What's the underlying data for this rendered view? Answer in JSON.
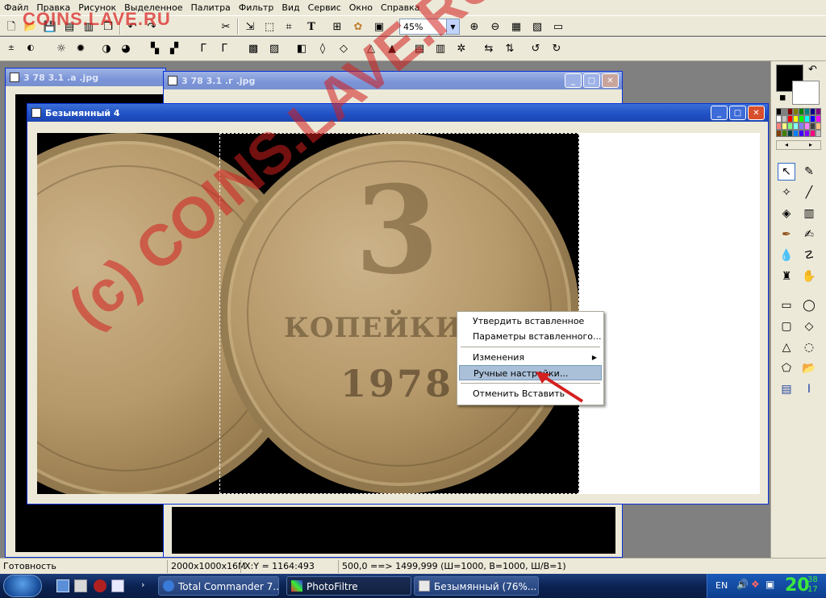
{
  "menu": [
    "Файл",
    "Правка",
    "Рисунок",
    "Выделенное",
    "Палитра",
    "Фильтр",
    "Вид",
    "Сервис",
    "Окно",
    "Справка"
  ],
  "toolbar": {
    "zoom_value": "45%"
  },
  "windows": {
    "back1_title": "3 78 3.1 .а .jpg",
    "back2_title": "3 78 3.1 .г .jpg",
    "main_title": "Безымянный 4"
  },
  "context_menu": {
    "items": [
      "Утвердить вставленное",
      "Параметры вставленного...",
      "Изменения",
      "Ручные настройки...",
      "Отменить Вставить"
    ]
  },
  "status": {
    "ready": "Готовность",
    "size": "2000x1000x16M",
    "xy": "X:Y = 1164:493",
    "selection": "500,0 ==> 1499,999 (Ш=1000, В=1000, Ш/В=1)"
  },
  "taskbar": {
    "tasks": [
      "Total Commander 7...",
      "PhotoFiltre",
      "Безымянный (76%..."
    ],
    "lang": "EN",
    "clock": "20",
    "clock_small_top": "38",
    "clock_small_bottom": "17"
  },
  "watermark": {
    "top": "COINS.LAVE.RU",
    "diagonal": "(c) COINS.LAVE.RU"
  },
  "coin": {
    "digit": "3",
    "year": "1978",
    "word": "КОПЕЙКИ"
  },
  "colors": {
    "title_active": "#1f4fc4",
    "title_inactive": "#7b94d8",
    "menu_highlight": "#a9c0d8",
    "taskbar": "#0b2353",
    "watermark": "#d21e1e"
  },
  "palette": [
    "#000000",
    "#808080",
    "#800000",
    "#808000",
    "#008000",
    "#008080",
    "#000080",
    "#800080",
    "#ffffff",
    "#c0c0c0",
    "#ff0000",
    "#ffff00",
    "#00ff00",
    "#00ffff",
    "#0000ff",
    "#ff00ff",
    "#ff8080",
    "#ffff80",
    "#80ff80",
    "#80ffff",
    "#8080ff",
    "#ff80ff",
    "#404040",
    "#ffc080",
    "#804000",
    "#408000",
    "#004040",
    "#0080ff",
    "#4000ff",
    "#8000ff",
    "#ff0080",
    "#c0c0c0"
  ]
}
